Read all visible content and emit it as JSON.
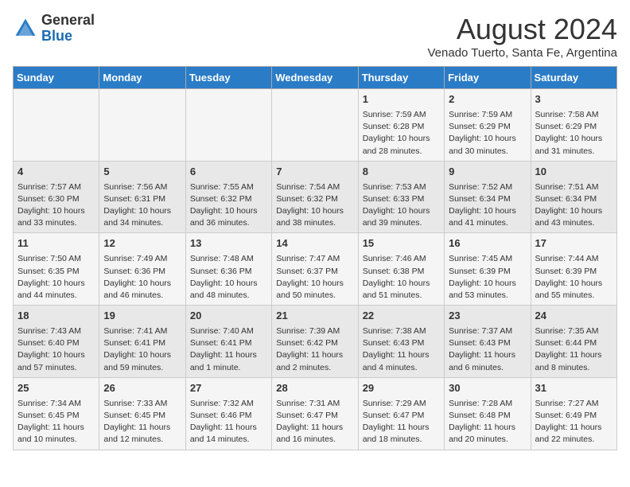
{
  "header": {
    "logo_general": "General",
    "logo_blue": "Blue",
    "month_title": "August 2024",
    "location": "Venado Tuerto, Santa Fe, Argentina"
  },
  "days_of_week": [
    "Sunday",
    "Monday",
    "Tuesday",
    "Wednesday",
    "Thursday",
    "Friday",
    "Saturday"
  ],
  "weeks": [
    [
      {
        "day": "",
        "info": ""
      },
      {
        "day": "",
        "info": ""
      },
      {
        "day": "",
        "info": ""
      },
      {
        "day": "",
        "info": ""
      },
      {
        "day": "1",
        "info": "Sunrise: 7:59 AM\nSunset: 6:28 PM\nDaylight: 10 hours\nand 28 minutes."
      },
      {
        "day": "2",
        "info": "Sunrise: 7:59 AM\nSunset: 6:29 PM\nDaylight: 10 hours\nand 30 minutes."
      },
      {
        "day": "3",
        "info": "Sunrise: 7:58 AM\nSunset: 6:29 PM\nDaylight: 10 hours\nand 31 minutes."
      }
    ],
    [
      {
        "day": "4",
        "info": "Sunrise: 7:57 AM\nSunset: 6:30 PM\nDaylight: 10 hours\nand 33 minutes."
      },
      {
        "day": "5",
        "info": "Sunrise: 7:56 AM\nSunset: 6:31 PM\nDaylight: 10 hours\nand 34 minutes."
      },
      {
        "day": "6",
        "info": "Sunrise: 7:55 AM\nSunset: 6:32 PM\nDaylight: 10 hours\nand 36 minutes."
      },
      {
        "day": "7",
        "info": "Sunrise: 7:54 AM\nSunset: 6:32 PM\nDaylight: 10 hours\nand 38 minutes."
      },
      {
        "day": "8",
        "info": "Sunrise: 7:53 AM\nSunset: 6:33 PM\nDaylight: 10 hours\nand 39 minutes."
      },
      {
        "day": "9",
        "info": "Sunrise: 7:52 AM\nSunset: 6:34 PM\nDaylight: 10 hours\nand 41 minutes."
      },
      {
        "day": "10",
        "info": "Sunrise: 7:51 AM\nSunset: 6:34 PM\nDaylight: 10 hours\nand 43 minutes."
      }
    ],
    [
      {
        "day": "11",
        "info": "Sunrise: 7:50 AM\nSunset: 6:35 PM\nDaylight: 10 hours\nand 44 minutes."
      },
      {
        "day": "12",
        "info": "Sunrise: 7:49 AM\nSunset: 6:36 PM\nDaylight: 10 hours\nand 46 minutes."
      },
      {
        "day": "13",
        "info": "Sunrise: 7:48 AM\nSunset: 6:36 PM\nDaylight: 10 hours\nand 48 minutes."
      },
      {
        "day": "14",
        "info": "Sunrise: 7:47 AM\nSunset: 6:37 PM\nDaylight: 10 hours\nand 50 minutes."
      },
      {
        "day": "15",
        "info": "Sunrise: 7:46 AM\nSunset: 6:38 PM\nDaylight: 10 hours\nand 51 minutes."
      },
      {
        "day": "16",
        "info": "Sunrise: 7:45 AM\nSunset: 6:39 PM\nDaylight: 10 hours\nand 53 minutes."
      },
      {
        "day": "17",
        "info": "Sunrise: 7:44 AM\nSunset: 6:39 PM\nDaylight: 10 hours\nand 55 minutes."
      }
    ],
    [
      {
        "day": "18",
        "info": "Sunrise: 7:43 AM\nSunset: 6:40 PM\nDaylight: 10 hours\nand 57 minutes."
      },
      {
        "day": "19",
        "info": "Sunrise: 7:41 AM\nSunset: 6:41 PM\nDaylight: 10 hours\nand 59 minutes."
      },
      {
        "day": "20",
        "info": "Sunrise: 7:40 AM\nSunset: 6:41 PM\nDaylight: 11 hours\nand 1 minute."
      },
      {
        "day": "21",
        "info": "Sunrise: 7:39 AM\nSunset: 6:42 PM\nDaylight: 11 hours\nand 2 minutes."
      },
      {
        "day": "22",
        "info": "Sunrise: 7:38 AM\nSunset: 6:43 PM\nDaylight: 11 hours\nand 4 minutes."
      },
      {
        "day": "23",
        "info": "Sunrise: 7:37 AM\nSunset: 6:43 PM\nDaylight: 11 hours\nand 6 minutes."
      },
      {
        "day": "24",
        "info": "Sunrise: 7:35 AM\nSunset: 6:44 PM\nDaylight: 11 hours\nand 8 minutes."
      }
    ],
    [
      {
        "day": "25",
        "info": "Sunrise: 7:34 AM\nSunset: 6:45 PM\nDaylight: 11 hours\nand 10 minutes."
      },
      {
        "day": "26",
        "info": "Sunrise: 7:33 AM\nSunset: 6:45 PM\nDaylight: 11 hours\nand 12 minutes."
      },
      {
        "day": "27",
        "info": "Sunrise: 7:32 AM\nSunset: 6:46 PM\nDaylight: 11 hours\nand 14 minutes."
      },
      {
        "day": "28",
        "info": "Sunrise: 7:31 AM\nSunset: 6:47 PM\nDaylight: 11 hours\nand 16 minutes."
      },
      {
        "day": "29",
        "info": "Sunrise: 7:29 AM\nSunset: 6:47 PM\nDaylight: 11 hours\nand 18 minutes."
      },
      {
        "day": "30",
        "info": "Sunrise: 7:28 AM\nSunset: 6:48 PM\nDaylight: 11 hours\nand 20 minutes."
      },
      {
        "day": "31",
        "info": "Sunrise: 7:27 AM\nSunset: 6:49 PM\nDaylight: 11 hours\nand 22 minutes."
      }
    ]
  ]
}
